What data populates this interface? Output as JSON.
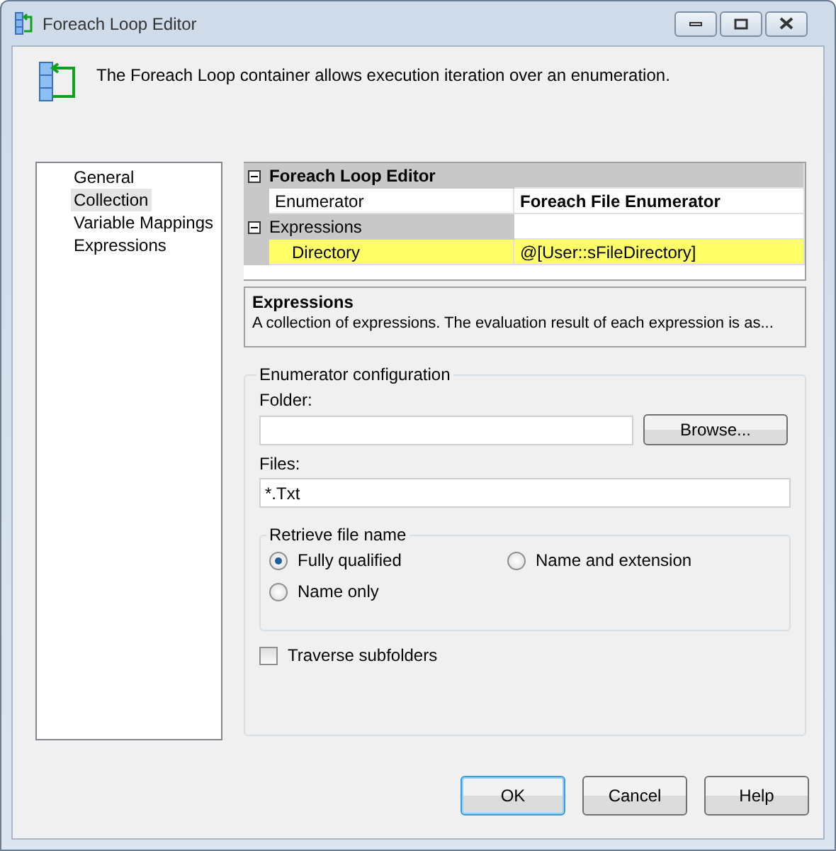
{
  "window": {
    "title": "Foreach Loop Editor"
  },
  "header": {
    "description": "The Foreach Loop container allows execution iteration over an enumeration."
  },
  "nav": [
    {
      "label": "General",
      "selected": false
    },
    {
      "label": "Collection",
      "selected": true
    },
    {
      "label": "Variable Mappings",
      "selected": false
    },
    {
      "label": "Expressions",
      "selected": false
    }
  ],
  "property_grid": {
    "categories": [
      {
        "label": "Foreach Loop Editor",
        "expanded": true,
        "rows": [
          {
            "name": "Enumerator",
            "value": "Foreach File Enumerator",
            "bold_value": true,
            "highlighted": false
          }
        ]
      },
      {
        "label": "Expressions",
        "expanded": true,
        "rows": [
          {
            "name": "Directory",
            "value": "@[User::sFileDirectory]",
            "bold_value": false,
            "highlighted": true
          }
        ]
      }
    ]
  },
  "description_box": {
    "title": "Expressions",
    "text": "A collection of expressions. The evaluation result of each expression is as..."
  },
  "enumerator_configuration": {
    "title": "Enumerator configuration",
    "folder": {
      "label": "Folder:"
    },
    "browse_button": "Browse...",
    "files": {
      "label": "Files:",
      "value": "*.Txt"
    },
    "retrieve_file_name": {
      "title": "Retrieve file name",
      "options": [
        {
          "label": "Fully qualified",
          "selected": true
        },
        {
          "label": "Name and extension",
          "selected": false
        },
        {
          "label": "Name only",
          "selected": false
        }
      ]
    },
    "traverse_subfolders": {
      "label": "Traverse subfolders",
      "checked": false
    }
  },
  "buttons": [
    {
      "label": "OK",
      "default": true
    },
    {
      "label": "Cancel",
      "default": false
    },
    {
      "label": "Help",
      "default": false
    }
  ]
}
